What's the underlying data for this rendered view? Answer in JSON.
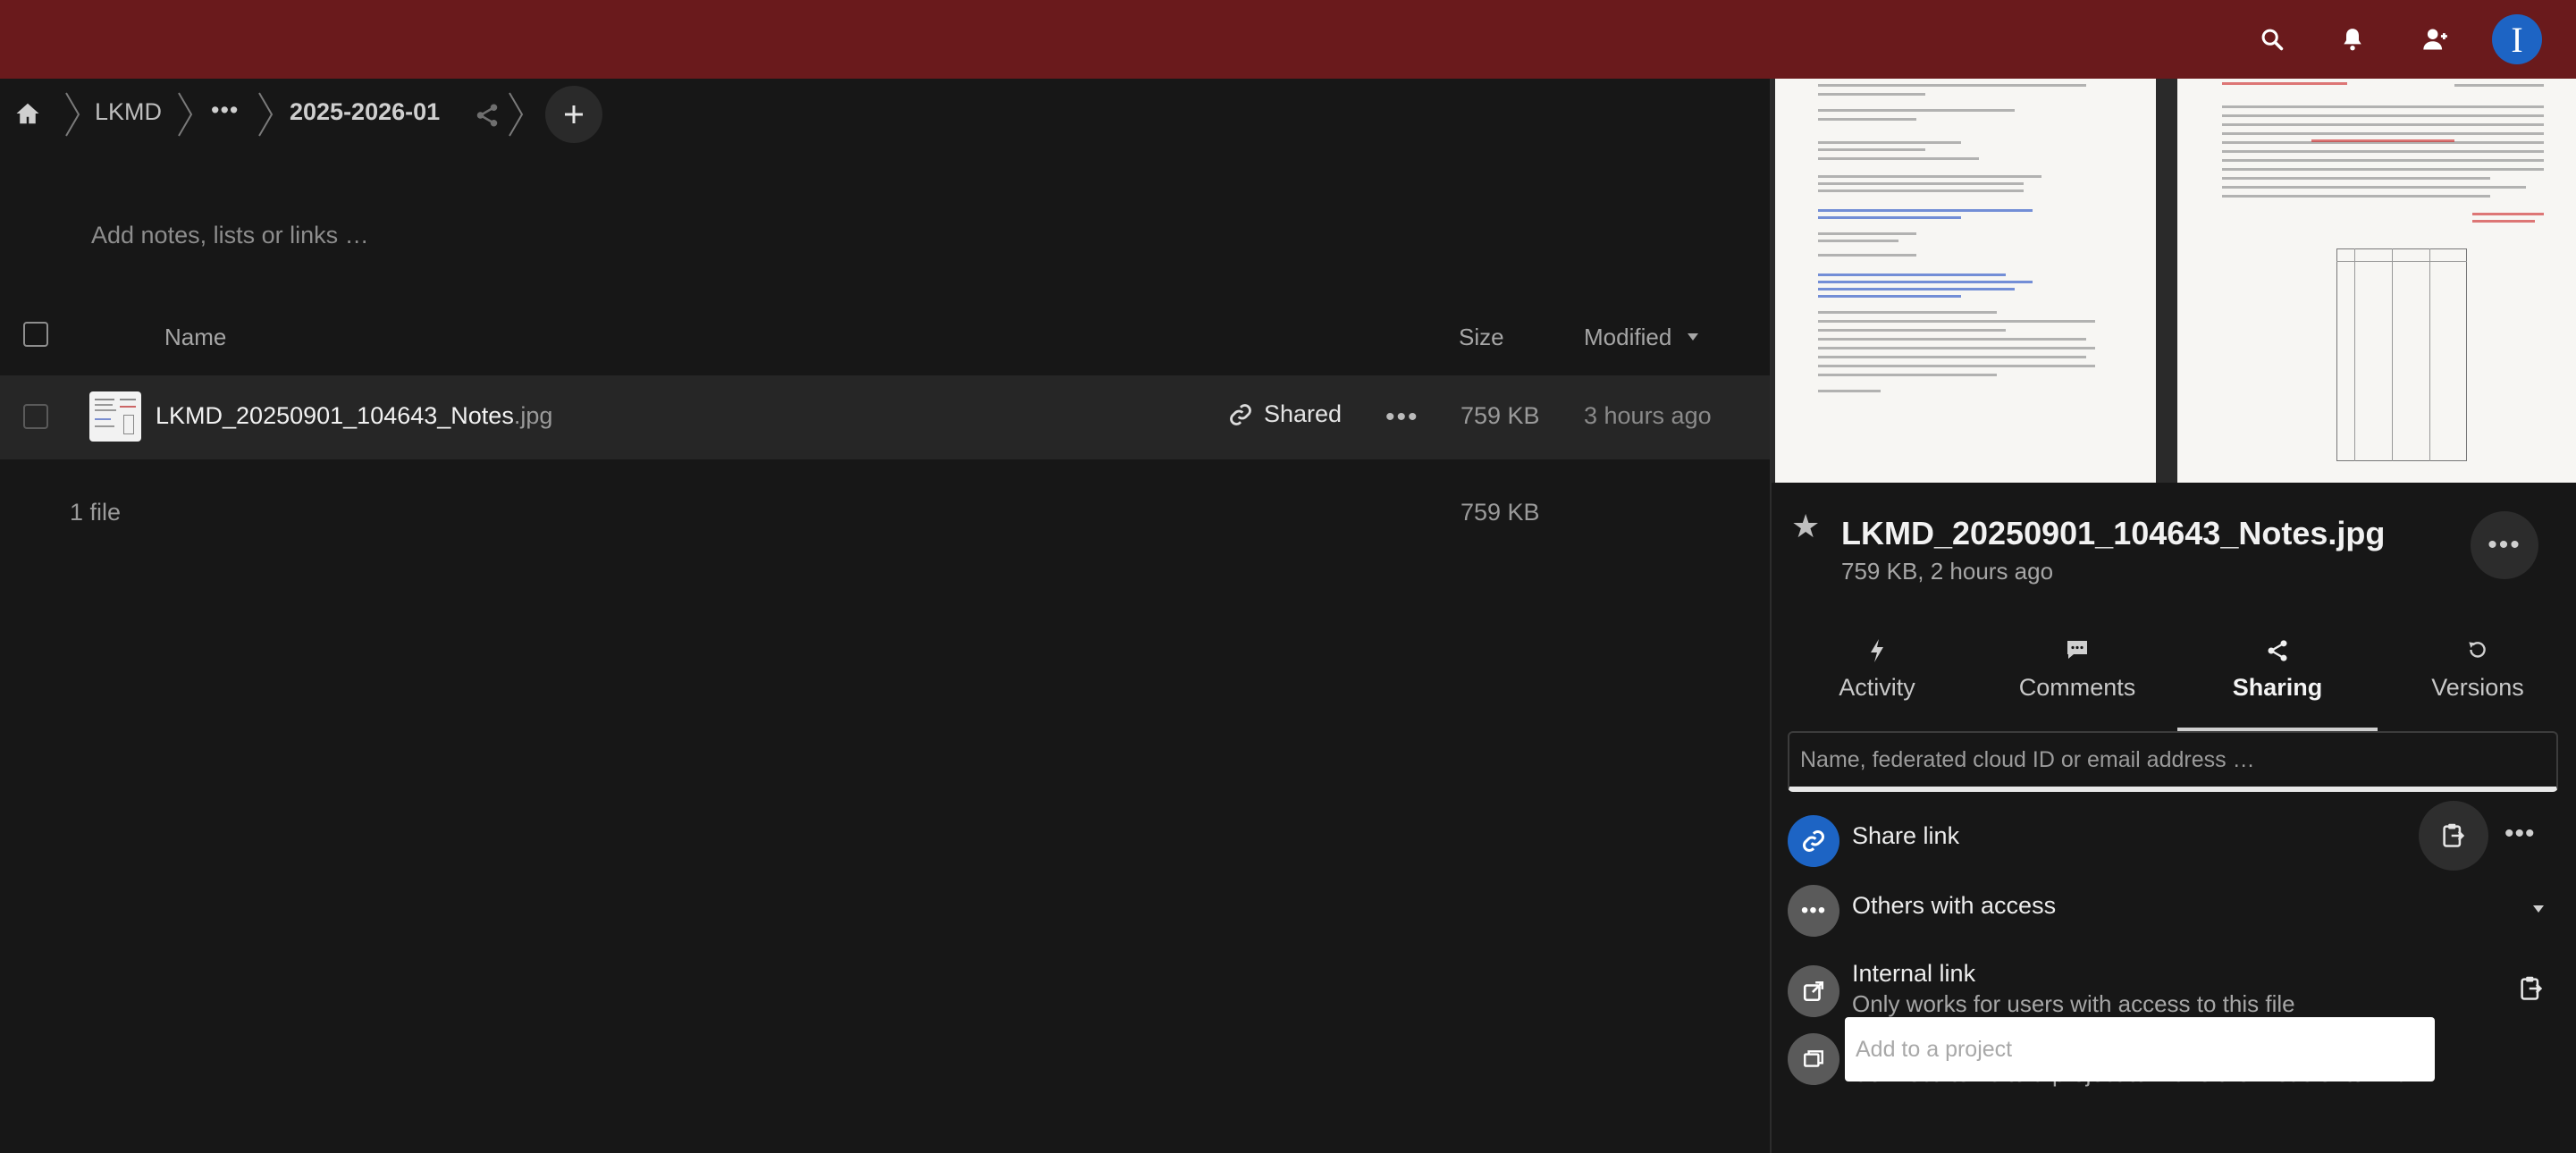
{
  "header": {
    "search_icon": "search-icon",
    "notifications_icon": "bell-icon",
    "contacts_icon": "contacts-icon",
    "user_initial": "I",
    "avatar_color": "#1d64c4",
    "bar_color": "#6a1a1c"
  },
  "breadcrumb": {
    "items": [
      "LKMD",
      "2025-2026-01"
    ],
    "more": "•••",
    "add": "+"
  },
  "notes_placeholder": "Add notes, lists or links …",
  "table": {
    "columns": {
      "name": "Name",
      "size": "Size",
      "modified": "Modified"
    },
    "rows": [
      {
        "basename": "LKMD_20250901_104643_Notes",
        "extension": ".jpg",
        "shared_label": "Shared",
        "size": "759 KB",
        "modified": "3 hours ago"
      }
    ],
    "summary": {
      "count": "1 file",
      "total_size": "759 KB"
    }
  },
  "sidebar": {
    "filename": "LKMD_20250901_104643_Notes.jpg",
    "meta": "759 KB, 2 hours ago",
    "tabs": [
      {
        "label": "Activity",
        "icon": "bolt-icon"
      },
      {
        "label": "Comments",
        "icon": "comment-icon"
      },
      {
        "label": "Sharing",
        "icon": "share-icon"
      },
      {
        "label": "Versions",
        "icon": "history-icon"
      }
    ],
    "active_tab": "Sharing",
    "share_input_placeholder": "Name, federated cloud ID or email address …",
    "share_link": {
      "label": "Share link",
      "color": "#1d64c4"
    },
    "others_access": {
      "label": "Others with access"
    },
    "internal_link": {
      "label": "Internal link",
      "sub": "Only works for users with access to this file"
    },
    "project": {
      "placeholder": "Add to a project",
      "hint": "Connect items to a project to make them easier to find"
    }
  }
}
